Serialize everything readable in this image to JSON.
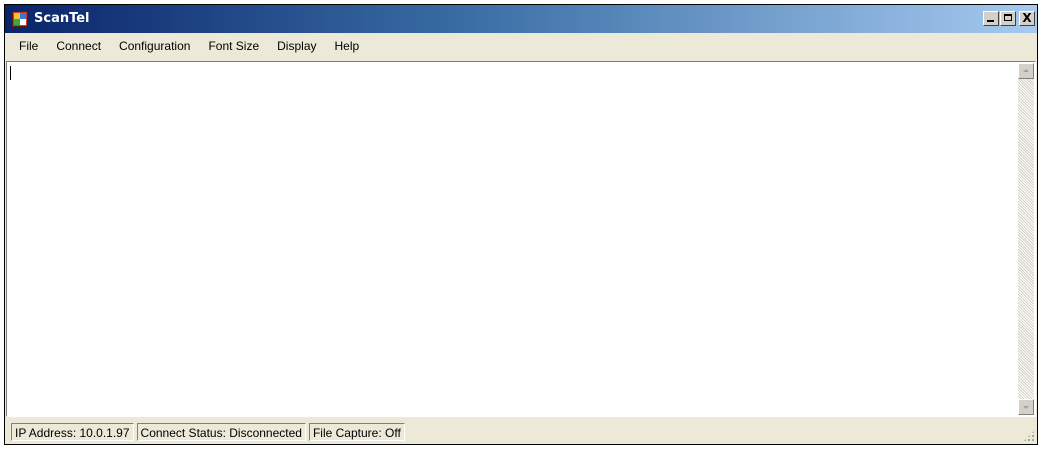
{
  "window": {
    "title": "ScanTel",
    "icon": "scantel-app-icon",
    "title_gradient": [
      "#0a246a",
      "#a6caf0"
    ],
    "controls": {
      "minimize_icon": "minimize-icon",
      "maximize_icon": "maximize-icon",
      "close_glyph": "X"
    }
  },
  "menu": {
    "items": [
      {
        "label": "File"
      },
      {
        "label": "Connect"
      },
      {
        "label": "Configuration"
      },
      {
        "label": "Font Size"
      },
      {
        "label": "Display"
      },
      {
        "label": "Help"
      }
    ]
  },
  "terminal": {
    "content": ""
  },
  "statusbar": {
    "ip_address": "IP Address: 10.0.1.97",
    "connect_status": "Connect Status: Disconnected",
    "file_capture": "File Capture: Off"
  }
}
